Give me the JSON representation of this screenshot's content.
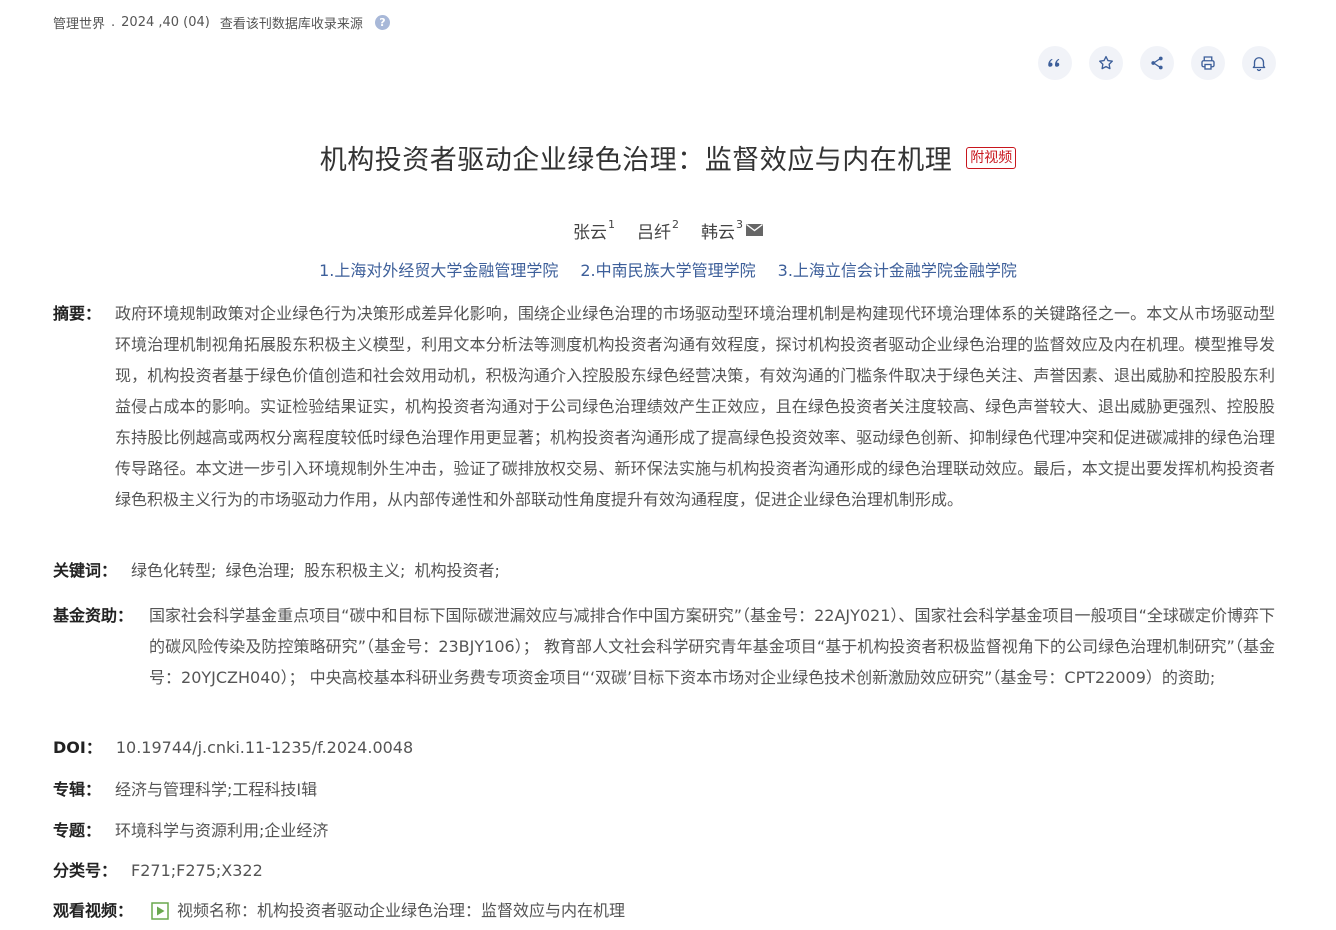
{
  "source_bar": {
    "journal": "管理世界",
    "dot": ".",
    "issue": "2024 ,40 (04)",
    "db_link": "查看该刊数据库收录来源",
    "help": "?"
  },
  "toolbar": [
    {
      "name": "quote-icon"
    },
    {
      "name": "star-icon"
    },
    {
      "name": "share-icon"
    },
    {
      "name": "print-icon"
    },
    {
      "name": "bell-icon"
    }
  ],
  "title": "机构投资者驱动企业绿色治理：监督效应与内在机理",
  "video_badge": "附视频",
  "authors": [
    {
      "name": "张云",
      "sup": "1"
    },
    {
      "name": "吕纤",
      "sup": "2"
    },
    {
      "name": "韩云",
      "sup": "3"
    }
  ],
  "affiliations": [
    "1.上海对外经贸大学金融管理学院",
    "2.中南民族大学管理学院",
    "3.上海立信会计金融学院金融学院"
  ],
  "abstract": {
    "label": "摘要：",
    "text": "政府环境规制政策对企业绿色行为决策形成差异化影响，围绕企业绿色治理的市场驱动型环境治理机制是构建现代环境治理体系的关键路径之一。本文从市场驱动型环境治理机制视角拓展股东积极主义模型，利用文本分析法等测度机构投资者沟通有效程度，探讨机构投资者驱动企业绿色治理的监督效应及内在机理。模型推导发现，机构投资者基于绿色价值创造和社会效用动机，积极沟通介入控股股东绿色经营决策，有效沟通的门槛条件取决于绿色关注、声誉因素、退出威胁和控股股东利益侵占成本的影响。实证检验结果证实，机构投资者沟通对于公司绿色治理绩效产生正效应，且在绿色投资者关注度较高、绿色声誉较大、退出威胁更强烈、控股股东持股比例越高或两权分离程度较低时绿色治理作用更显著；机构投资者沟通形成了提高绿色投资效率、驱动绿色创新、抑制绿色代理冲突和促进碳减排的绿色治理传导路径。本文进一步引入环境规制外生冲击，验证了碳排放权交易、新环保法实施与机构投资者沟通形成的绿色治理联动效应。最后，本文提出要发挥机构投资者绿色积极主义行为的市场驱动力作用，从内部传递性和外部联动性角度提升有效沟通程度，促进企业绿色治理机制形成。"
  },
  "keywords": {
    "label": "关键词：",
    "items": [
      "绿色化转型;",
      "绿色治理;",
      "股东积极主义;",
      "机构投资者;"
    ]
  },
  "fund": {
    "label": "基金资助：",
    "text": "国家社会科学基金重点项目“碳中和目标下国际碳泄漏效应与减排合作中国方案研究”（基金号：22AJY021）、国家社会科学基金项目一般项目“全球碳定价博弈下的碳风险传染及防控策略研究”（基金号：23BJY106）； 教育部人文社会科学研究青年基金项目“基于机构投资者积极监督视角下的公司绿色治理机制研究”（基金号：20YJCZH040）； 中央高校基本科研业务费专项资金项目“‘双碳’目标下资本市场对企业绿色技术创新激励效应研究”（基金号：CPT22009）的资助;"
  },
  "doi": {
    "label": "DOI：",
    "value": "10.19744/j.cnki.11-1235/f.2024.0048"
  },
  "zhuanji": {
    "label": "专辑：",
    "value": "经济与管理科学;工程科技Ⅰ辑"
  },
  "zhuanti": {
    "label": "专题：",
    "value": "环境科学与资源利用;企业经济"
  },
  "classification": {
    "label": "分类号：",
    "value": "F271;F275;X322"
  },
  "video": {
    "label": "观看视频：",
    "value": "视频名称：机构投资者驱动企业绿色治理：监督效应与内在机理"
  },
  "colors": {
    "link": "#3d5f9a",
    "badge": "#c8161d",
    "play": "#6aa84f"
  }
}
